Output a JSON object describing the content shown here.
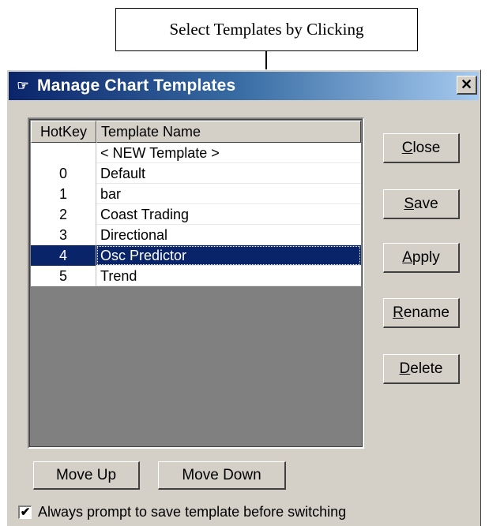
{
  "callout": {
    "text": "Select Templates by Clicking"
  },
  "window": {
    "title": "Manage Chart Templates",
    "close_glyph": "✕"
  },
  "list": {
    "columns": {
      "hotkey": "HotKey",
      "name": "Template Name"
    },
    "rows": [
      {
        "hotkey": "",
        "name": "< NEW Template >"
      },
      {
        "hotkey": "0",
        "name": "Default"
      },
      {
        "hotkey": "1",
        "name": "bar"
      },
      {
        "hotkey": "2",
        "name": "Coast Trading"
      },
      {
        "hotkey": "3",
        "name": "Directional"
      },
      {
        "hotkey": "4",
        "name": "Osc Predictor"
      },
      {
        "hotkey": "5",
        "name": "Trend"
      }
    ],
    "selected_index": 5
  },
  "buttons": {
    "close": {
      "mnemonic": "C",
      "rest": "lose"
    },
    "save": {
      "mnemonic": "S",
      "rest": "ave"
    },
    "apply": {
      "mnemonic": "A",
      "rest": "pply"
    },
    "rename": {
      "mnemonic": "R",
      "rest": "ename"
    },
    "delete": {
      "mnemonic": "D",
      "rest": "elete"
    },
    "move_up": "Move Up",
    "move_down": "Move Down"
  },
  "checkbox": {
    "label": "Always prompt to save template before switching",
    "checked": true,
    "check_glyph": "✔"
  },
  "colors": {
    "selection": "#0a246a",
    "title_start": "#0a246a",
    "title_end": "#a6caf0",
    "face": "#d4d0c8"
  },
  "icons": {
    "title": "pointing-hand-icon"
  }
}
